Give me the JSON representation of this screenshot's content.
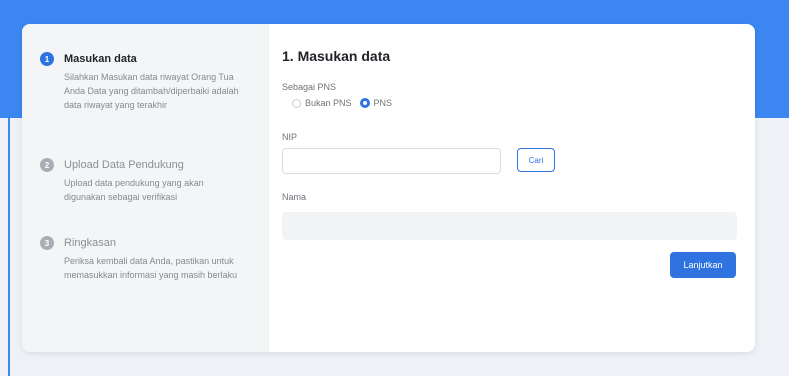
{
  "colors": {
    "accent": "#2f73e0",
    "header_bg": "#3b86f0",
    "sidebar_bg": "#f4f5f7"
  },
  "steps": [
    {
      "number": "1",
      "title": "Masukan data",
      "description": "Silahkan Masukan data riwayat Orang Tua Anda Data yang ditambah/diperbaiki adalah data riwayat yang terakhir",
      "active": true
    },
    {
      "number": "2",
      "title": "Upload Data Pendukung",
      "description": "Upload data pendukung yang akan digunakan sebagai verifikasi",
      "active": false
    },
    {
      "number": "3",
      "title": "Ringkasan",
      "description": "Periksa kembali data Anda, pastikan untuk memasukkan informasi yang masih berlaku",
      "active": false
    }
  ],
  "form": {
    "title": "1. Masukan data",
    "pns_label": "Sebagai PNS",
    "options": [
      {
        "label": "Bukan PNS",
        "selected": false
      },
      {
        "label": "PNS",
        "selected": true
      }
    ],
    "nip_label": "NIP",
    "nip_value": "",
    "cari_label": "Cari",
    "nama_label": "Nama",
    "nama_value": "",
    "next_label": "Lanjutkan"
  }
}
